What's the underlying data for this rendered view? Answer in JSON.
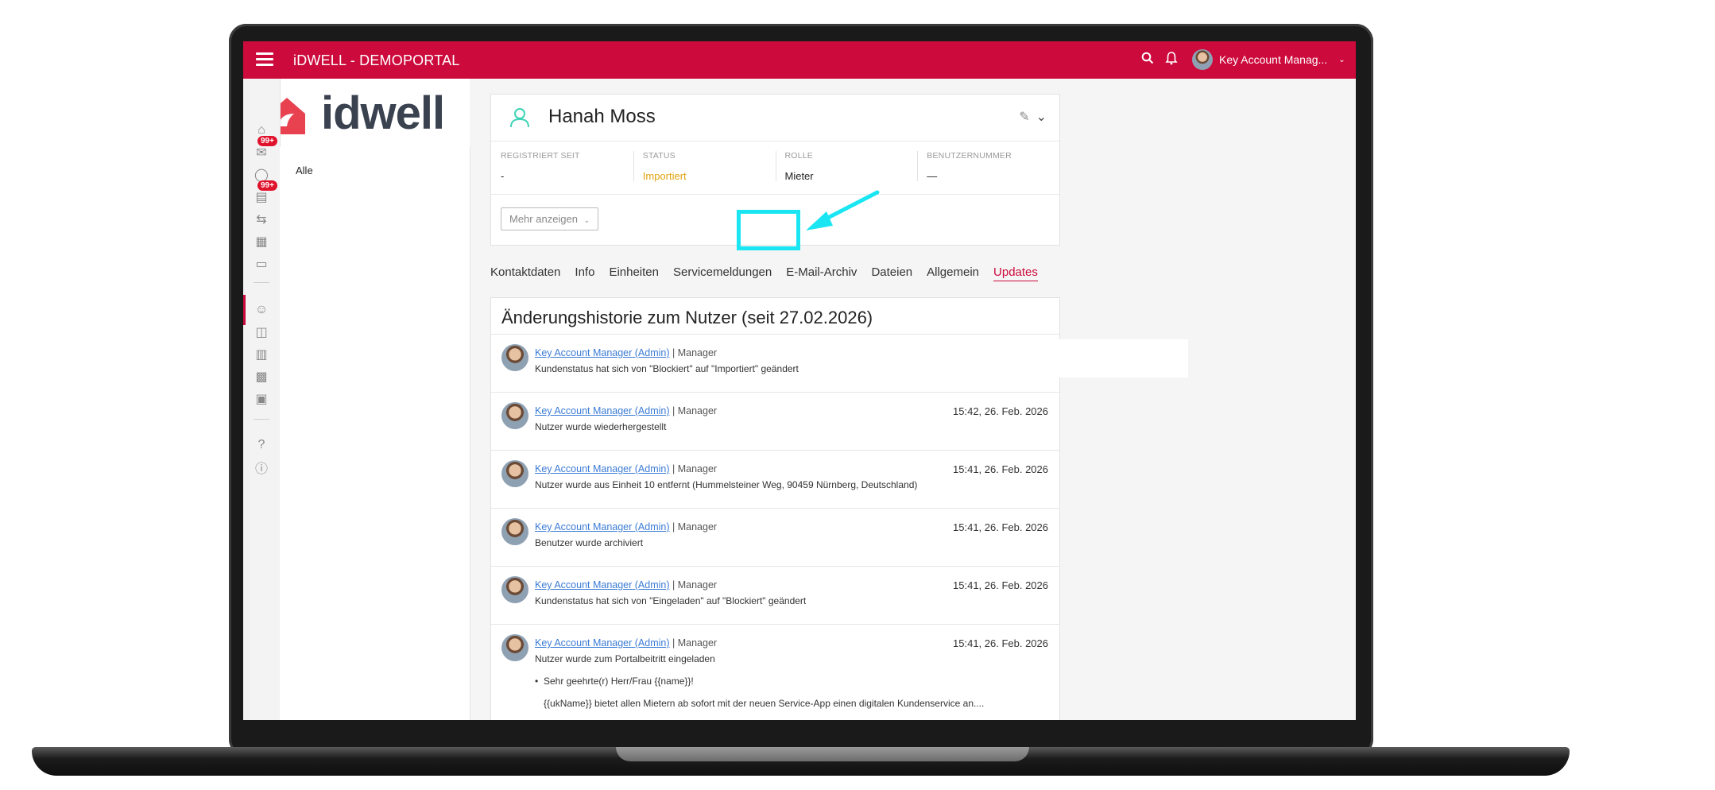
{
  "app": {
    "title": "iDWELL - DEMOPORTAL"
  },
  "topbar": {
    "user_name": "Key Account Manag...",
    "icons": [
      "search-icon",
      "bell-icon",
      "chevron-down-icon"
    ]
  },
  "logo": {
    "text": "idwell"
  },
  "rail": {
    "badges": [
      "99+",
      "99+"
    ],
    "icons": [
      "home-icon",
      "inbox-icon",
      "chat-icon",
      "tasks-icon",
      "transfer-icon",
      "calendar-icon",
      "folder-icon",
      "user-icon",
      "floorplan-icon",
      "building-icon",
      "buildings-icon",
      "truck-icon",
      "help-icon",
      "info-icon"
    ]
  },
  "subnav": {
    "items": [
      "Alle"
    ]
  },
  "profile": {
    "name": "Hanah Moss",
    "fields": [
      {
        "label": "REGISTRIERT SEIT",
        "value": "-"
      },
      {
        "label": "STATUS",
        "value": "Importiert"
      },
      {
        "label": "ROLLE",
        "value": "Mieter"
      },
      {
        "label": "BENUTZERNUMMER",
        "value": "—"
      }
    ],
    "more_button": "Mehr anzeigen"
  },
  "tabs": [
    "Kontaktdaten",
    "Info",
    "Einheiten",
    "Servicemeldungen",
    "E-Mail-Archiv",
    "Dateien",
    "Allgemein",
    "Updates"
  ],
  "active_tab": "Updates",
  "history": {
    "title": "Änderungshistorie zum Nutzer (seit 27.02.2026)",
    "entries": [
      {
        "author": "Key Account Manager (Admin)",
        "role": "| Manager",
        "text": "Kundenstatus hat sich von \"Blockiert\" auf \"Importiert\" geändert",
        "time": ""
      },
      {
        "author": "Key Account Manager (Admin)",
        "role": "| Manager",
        "text": "Nutzer wurde wiederhergestellt",
        "time": "15:42, 26. Feb. 2026"
      },
      {
        "author": "Key Account Manager (Admin)",
        "role": "| Manager",
        "text": "Nutzer wurde aus Einheit 10 entfernt (Hummelsteiner Weg, 90459 Nürnberg, Deutschland)",
        "time": "15:41, 26. Feb. 2026"
      },
      {
        "author": "Key Account Manager (Admin)",
        "role": "| Manager",
        "text": "Benutzer wurde archiviert",
        "time": "15:41, 26. Feb. 2026"
      },
      {
        "author": "Key Account Manager (Admin)",
        "role": "| Manager",
        "text": "Kundenstatus hat sich von \"Eingeladen\" auf \"Blockiert\" geändert",
        "time": "15:41, 26. Feb. 2026"
      },
      {
        "author": "Key Account Manager (Admin)",
        "role": "| Manager",
        "text": "Nutzer wurde zum Portalbeitritt eingeladen",
        "time": "15:41, 26. Feb. 2026",
        "bullet": "Sehr geehrte(r) Herr/Frau {{name}}!",
        "sub": "{{ukName}} bietet allen Mietern ab sofort mit der neuen Service-App einen digitalen Kundenservice an...."
      }
    ]
  },
  "colors": {
    "brand": "#cc0a3c",
    "status": "#e0a20c",
    "link": "#3a7bd5",
    "highlight": "#19e6f2"
  }
}
